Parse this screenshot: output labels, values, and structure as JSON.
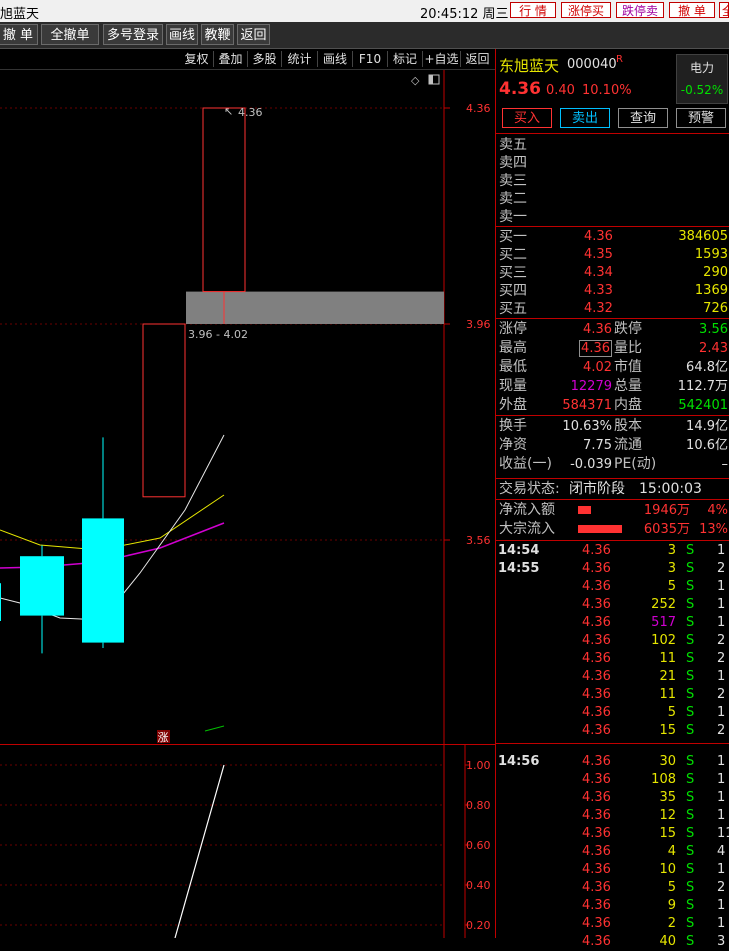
{
  "titlebar": {
    "stock_name": "旭蓝天",
    "time": "20:45:12 周三",
    "buttons": [
      "行  情",
      "涨停买",
      "跌停卖",
      "撤  单",
      "全"
    ]
  },
  "toolbar": {
    "items": [
      "撤 单",
      "全撤单",
      "多号登录",
      "画线",
      "教鞭",
      "返回"
    ]
  },
  "chart_menu": {
    "items": [
      "复权",
      "叠加",
      "多股",
      "统计",
      "画线",
      "F10",
      "标记",
      "+自选",
      "返回"
    ]
  },
  "chart_data": {
    "type": "candlestick",
    "price_axis": {
      "ticks": [
        "4.36",
        "3.96",
        "3.56"
      ],
      "range": [
        3.0,
        4.4
      ]
    },
    "candles": [
      {
        "open": 3.48,
        "close": 3.41,
        "high": 3.51,
        "low": 3.36
      },
      {
        "open": 3.53,
        "close": 3.42,
        "high": 3.55,
        "low": 3.35
      },
      {
        "open": 3.6,
        "close": 3.37,
        "high": 3.75,
        "low": 3.36
      },
      {
        "open": 3.64,
        "close": 3.96,
        "high": 3.96,
        "low": 3.64
      },
      {
        "open": 4.02,
        "close": 4.36,
        "high": 4.36,
        "low": 3.96
      }
    ],
    "gap_band": [
      3.96,
      4.02
    ],
    "gap_label": "3.96 - 4.02",
    "high_marker": "4.36",
    "flag_text": "涨",
    "indicator_axis": {
      "ticks": [
        "1.00",
        "0.80",
        "0.60",
        "0.40",
        "0.20"
      ],
      "range": [
        0.0,
        1.0
      ]
    },
    "colors": {
      "up": "#ff3232",
      "down": "#00ffff",
      "ma_white": "#e8e8e8",
      "ma_yellow": "#e6e600",
      "ma_purple": "#d000d0",
      "gap": "#808080"
    }
  },
  "quote": {
    "name": "东旭蓝天",
    "code": "000040",
    "code_flag": "R",
    "price": "4.36",
    "change": "0.40",
    "pct": "10.10%",
    "sector": "电力",
    "sector_pct": "-0.52%",
    "buttons": [
      "买入",
      "卖出",
      "查询",
      "预警"
    ],
    "sell_levels": [
      "卖五",
      "卖四",
      "卖三",
      "卖二",
      "卖一"
    ],
    "buy_levels": [
      {
        "label": "买一",
        "price": "4.36",
        "vol": "384605"
      },
      {
        "label": "买二",
        "price": "4.35",
        "vol": "1593"
      },
      {
        "label": "买三",
        "price": "4.34",
        "vol": "290"
      },
      {
        "label": "买四",
        "price": "4.33",
        "vol": "1369"
      },
      {
        "label": "买五",
        "price": "4.32",
        "vol": "726"
      }
    ],
    "stats": [
      {
        "l1": "涨停",
        "v1": "4.36",
        "l2": "跌停",
        "v2": "3.56"
      },
      {
        "l1": "最高",
        "v1": "4.36",
        "l2": "量比",
        "v2": "2.43"
      },
      {
        "l1": "最低",
        "v1": "4.02",
        "l2": "市值",
        "v2": "64.8亿"
      },
      {
        "l1": "现量",
        "v1": "12279",
        "l2": "总量",
        "v2": "112.7万"
      },
      {
        "l1": "外盘",
        "v1": "584371",
        "l2": "内盘",
        "v2": "542401"
      }
    ],
    "fund": [
      {
        "l1": "换手",
        "v1": "10.63%",
        "l2": "股本",
        "v2": "14.9亿"
      },
      {
        "l1": "净资",
        "v1": "7.75",
        "l2": "流通",
        "v2": "10.6亿"
      },
      {
        "l1": "收益(一)",
        "v1": "-0.039",
        "l2": "PE(动)",
        "v2": "–"
      }
    ],
    "status_label": "交易状态:",
    "status_value": "闭市阶段",
    "status_time": "15:00:03",
    "flows": [
      {
        "label": "净流入额",
        "value": "1946万",
        "pct": "4%",
        "bar": 0.3
      },
      {
        "label": "大宗流入",
        "value": "6035万",
        "pct": "13%",
        "bar": 1.0
      }
    ]
  },
  "ticks": [
    {
      "time": "14:54",
      "price": "4.36",
      "vol": "3",
      "bs": "S",
      "n": "1"
    },
    {
      "time": "14:55",
      "price": "4.36",
      "vol": "3",
      "bs": "S",
      "n": "2"
    },
    {
      "time": "",
      "price": "4.36",
      "vol": "5",
      "bs": "S",
      "n": "1"
    },
    {
      "time": "",
      "price": "4.36",
      "vol": "252",
      "bs": "S",
      "n": "1"
    },
    {
      "time": "",
      "price": "4.36",
      "vol": "517",
      "bs": "S",
      "n": "1",
      "hl": true
    },
    {
      "time": "",
      "price": "4.36",
      "vol": "102",
      "bs": "S",
      "n": "2"
    },
    {
      "time": "",
      "price": "4.36",
      "vol": "11",
      "bs": "S",
      "n": "2"
    },
    {
      "time": "",
      "price": "4.36",
      "vol": "21",
      "bs": "S",
      "n": "1"
    },
    {
      "time": "",
      "price": "4.36",
      "vol": "11",
      "bs": "S",
      "n": "2"
    },
    {
      "time": "",
      "price": "4.36",
      "vol": "5",
      "bs": "S",
      "n": "1"
    },
    {
      "time": "",
      "price": "4.36",
      "vol": "15",
      "bs": "S",
      "n": "2"
    },
    {
      "time": "14:56",
      "price": "4.36",
      "vol": "30",
      "bs": "S",
      "n": "1"
    },
    {
      "time": "",
      "price": "4.36",
      "vol": "108",
      "bs": "S",
      "n": "1"
    },
    {
      "time": "",
      "price": "4.36",
      "vol": "35",
      "bs": "S",
      "n": "1"
    },
    {
      "time": "",
      "price": "4.36",
      "vol": "12",
      "bs": "S",
      "n": "1"
    },
    {
      "time": "",
      "price": "4.36",
      "vol": "15",
      "bs": "S",
      "n": "11"
    },
    {
      "time": "",
      "price": "4.36",
      "vol": "4",
      "bs": "S",
      "n": "4"
    },
    {
      "time": "",
      "price": "4.36",
      "vol": "10",
      "bs": "S",
      "n": "1"
    },
    {
      "time": "",
      "price": "4.36",
      "vol": "5",
      "bs": "S",
      "n": "2"
    },
    {
      "time": "",
      "price": "4.36",
      "vol": "9",
      "bs": "S",
      "n": "1"
    },
    {
      "time": "",
      "price": "4.36",
      "vol": "2",
      "bs": "S",
      "n": "1"
    },
    {
      "time": "",
      "price": "4.36",
      "vol": "40",
      "bs": "S",
      "n": "3"
    }
  ]
}
